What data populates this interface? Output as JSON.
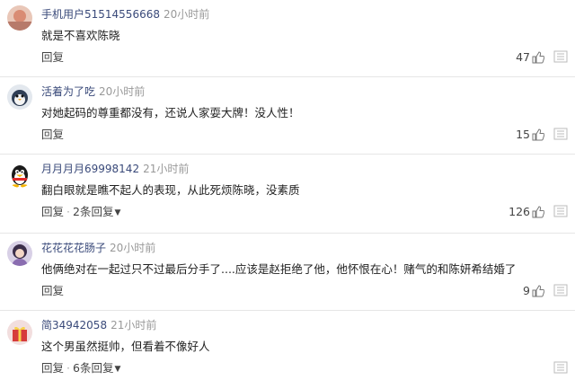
{
  "comments": [
    {
      "username": "手机用户51514556668",
      "time": "20小时前",
      "text": "就是不喜欢陈晓",
      "reply_label": "回复",
      "replies_label": "",
      "likes": "47",
      "avatar": "sunset-avatar"
    },
    {
      "username": "活着为了吃",
      "time": "20小时前",
      "text": "对她起码的尊重都没有，还说人家耍大牌！没人性！",
      "reply_label": "回复",
      "replies_label": "",
      "likes": "15",
      "avatar": "penguin-avatar"
    },
    {
      "username": "月月月月69998142",
      "time": "21小时前",
      "text": "翻白眼就是瞧不起人的表现，从此死烦陈晓，没素质",
      "reply_label": "回复",
      "replies_label": "2条回复",
      "likes": "126",
      "avatar": "qq-penguin-avatar"
    },
    {
      "username": "花花花花肠子",
      "time": "20小时前",
      "text": "他俩绝对在一起过只不过最后分手了....应该是赵拒绝了他，他怀恨在心！赌气的和陈妍希结婚了",
      "reply_label": "回复",
      "replies_label": "",
      "likes": "9",
      "avatar": "girl-avatar"
    },
    {
      "username": "简34942058",
      "time": "21小时前",
      "text": "这个男虽然挺帅，但看着不像好人",
      "reply_label": "回复",
      "replies_label": "6条回复",
      "likes": "",
      "avatar": "gift-avatar"
    }
  ],
  "colors": {
    "username": "#3a4a7a",
    "time": "#999999",
    "divider": "#e6e6e6"
  }
}
